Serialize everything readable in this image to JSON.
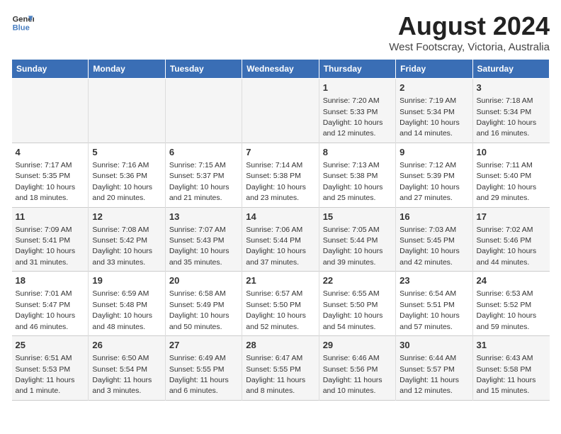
{
  "header": {
    "logo_line1": "General",
    "logo_line2": "Blue",
    "month_year": "August 2024",
    "location": "West Footscray, Victoria, Australia"
  },
  "weekdays": [
    "Sunday",
    "Monday",
    "Tuesday",
    "Wednesday",
    "Thursday",
    "Friday",
    "Saturday"
  ],
  "weeks": [
    [
      {
        "day": "",
        "info": ""
      },
      {
        "day": "",
        "info": ""
      },
      {
        "day": "",
        "info": ""
      },
      {
        "day": "",
        "info": ""
      },
      {
        "day": "1",
        "info": "Sunrise: 7:20 AM\nSunset: 5:33 PM\nDaylight: 10 hours\nand 12 minutes."
      },
      {
        "day": "2",
        "info": "Sunrise: 7:19 AM\nSunset: 5:34 PM\nDaylight: 10 hours\nand 14 minutes."
      },
      {
        "day": "3",
        "info": "Sunrise: 7:18 AM\nSunset: 5:34 PM\nDaylight: 10 hours\nand 16 minutes."
      }
    ],
    [
      {
        "day": "4",
        "info": "Sunrise: 7:17 AM\nSunset: 5:35 PM\nDaylight: 10 hours\nand 18 minutes."
      },
      {
        "day": "5",
        "info": "Sunrise: 7:16 AM\nSunset: 5:36 PM\nDaylight: 10 hours\nand 20 minutes."
      },
      {
        "day": "6",
        "info": "Sunrise: 7:15 AM\nSunset: 5:37 PM\nDaylight: 10 hours\nand 21 minutes."
      },
      {
        "day": "7",
        "info": "Sunrise: 7:14 AM\nSunset: 5:38 PM\nDaylight: 10 hours\nand 23 minutes."
      },
      {
        "day": "8",
        "info": "Sunrise: 7:13 AM\nSunset: 5:38 PM\nDaylight: 10 hours\nand 25 minutes."
      },
      {
        "day": "9",
        "info": "Sunrise: 7:12 AM\nSunset: 5:39 PM\nDaylight: 10 hours\nand 27 minutes."
      },
      {
        "day": "10",
        "info": "Sunrise: 7:11 AM\nSunset: 5:40 PM\nDaylight: 10 hours\nand 29 minutes."
      }
    ],
    [
      {
        "day": "11",
        "info": "Sunrise: 7:09 AM\nSunset: 5:41 PM\nDaylight: 10 hours\nand 31 minutes."
      },
      {
        "day": "12",
        "info": "Sunrise: 7:08 AM\nSunset: 5:42 PM\nDaylight: 10 hours\nand 33 minutes."
      },
      {
        "day": "13",
        "info": "Sunrise: 7:07 AM\nSunset: 5:43 PM\nDaylight: 10 hours\nand 35 minutes."
      },
      {
        "day": "14",
        "info": "Sunrise: 7:06 AM\nSunset: 5:44 PM\nDaylight: 10 hours\nand 37 minutes."
      },
      {
        "day": "15",
        "info": "Sunrise: 7:05 AM\nSunset: 5:44 PM\nDaylight: 10 hours\nand 39 minutes."
      },
      {
        "day": "16",
        "info": "Sunrise: 7:03 AM\nSunset: 5:45 PM\nDaylight: 10 hours\nand 42 minutes."
      },
      {
        "day": "17",
        "info": "Sunrise: 7:02 AM\nSunset: 5:46 PM\nDaylight: 10 hours\nand 44 minutes."
      }
    ],
    [
      {
        "day": "18",
        "info": "Sunrise: 7:01 AM\nSunset: 5:47 PM\nDaylight: 10 hours\nand 46 minutes."
      },
      {
        "day": "19",
        "info": "Sunrise: 6:59 AM\nSunset: 5:48 PM\nDaylight: 10 hours\nand 48 minutes."
      },
      {
        "day": "20",
        "info": "Sunrise: 6:58 AM\nSunset: 5:49 PM\nDaylight: 10 hours\nand 50 minutes."
      },
      {
        "day": "21",
        "info": "Sunrise: 6:57 AM\nSunset: 5:50 PM\nDaylight: 10 hours\nand 52 minutes."
      },
      {
        "day": "22",
        "info": "Sunrise: 6:55 AM\nSunset: 5:50 PM\nDaylight: 10 hours\nand 54 minutes."
      },
      {
        "day": "23",
        "info": "Sunrise: 6:54 AM\nSunset: 5:51 PM\nDaylight: 10 hours\nand 57 minutes."
      },
      {
        "day": "24",
        "info": "Sunrise: 6:53 AM\nSunset: 5:52 PM\nDaylight: 10 hours\nand 59 minutes."
      }
    ],
    [
      {
        "day": "25",
        "info": "Sunrise: 6:51 AM\nSunset: 5:53 PM\nDaylight: 11 hours\nand 1 minute."
      },
      {
        "day": "26",
        "info": "Sunrise: 6:50 AM\nSunset: 5:54 PM\nDaylight: 11 hours\nand 3 minutes."
      },
      {
        "day": "27",
        "info": "Sunrise: 6:49 AM\nSunset: 5:55 PM\nDaylight: 11 hours\nand 6 minutes."
      },
      {
        "day": "28",
        "info": "Sunrise: 6:47 AM\nSunset: 5:55 PM\nDaylight: 11 hours\nand 8 minutes."
      },
      {
        "day": "29",
        "info": "Sunrise: 6:46 AM\nSunset: 5:56 PM\nDaylight: 11 hours\nand 10 minutes."
      },
      {
        "day": "30",
        "info": "Sunrise: 6:44 AM\nSunset: 5:57 PM\nDaylight: 11 hours\nand 12 minutes."
      },
      {
        "day": "31",
        "info": "Sunrise: 6:43 AM\nSunset: 5:58 PM\nDaylight: 11 hours\nand 15 minutes."
      }
    ]
  ]
}
